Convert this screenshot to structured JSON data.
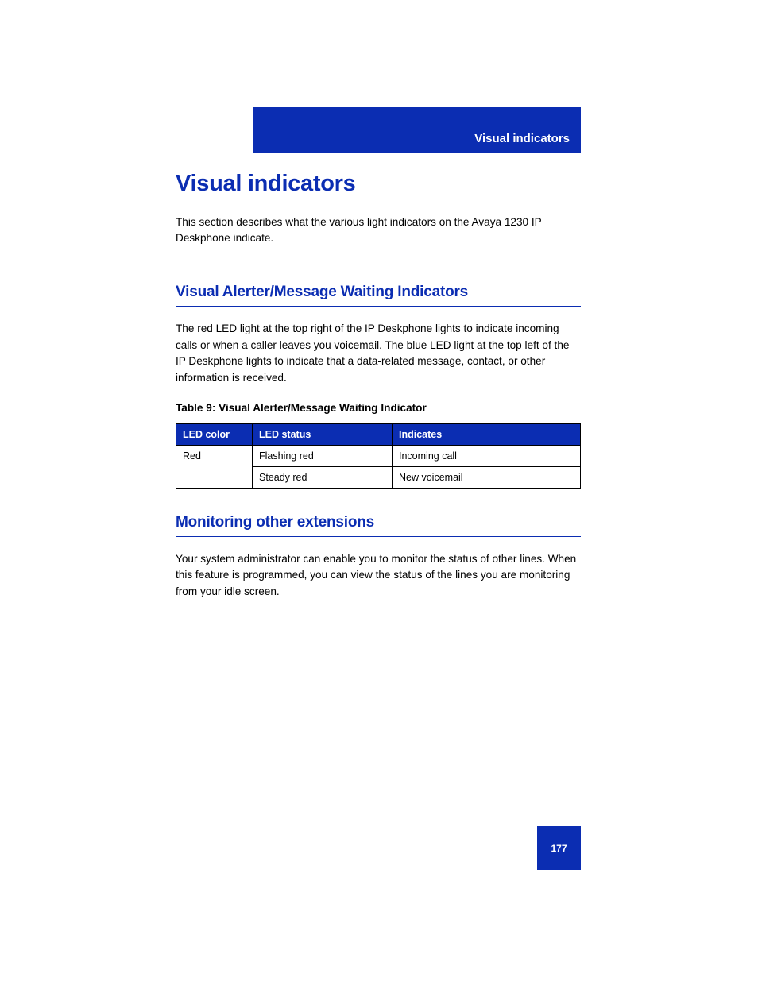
{
  "header": {
    "running_title": "Visual indicators"
  },
  "content": {
    "h1": "Visual indicators",
    "intro": "This section describes what the various light indicators on the Avaya 1230 IP Deskphone indicate.",
    "section1": {
      "heading": "Visual Alerter/Message Waiting Indicators",
      "para": "The red LED light at the top right of the IP Deskphone lights to indicate incoming calls or when a caller leaves you voicemail. The blue LED light at the top left of the IP Deskphone lights to indicate that a data-related message, contact, or other information is received.",
      "table_caption": "Table 9: Visual Alerter/Message Waiting Indicator",
      "table": {
        "headers": [
          "LED color",
          "LED status",
          "Indicates"
        ],
        "rows": [
          {
            "color": "Red",
            "status": "Flashing red",
            "meaning": "Incoming call"
          },
          {
            "color_span": true,
            "status": "Steady red",
            "meaning": "New voicemail"
          }
        ]
      }
    },
    "section2": {
      "heading": "Monitoring other extensions",
      "para": "Your system administrator can enable you to monitor the status of other lines. When this feature is programmed, you can view the status of the lines you are monitoring from your idle screen."
    }
  },
  "footer": {
    "page_number": "177"
  }
}
